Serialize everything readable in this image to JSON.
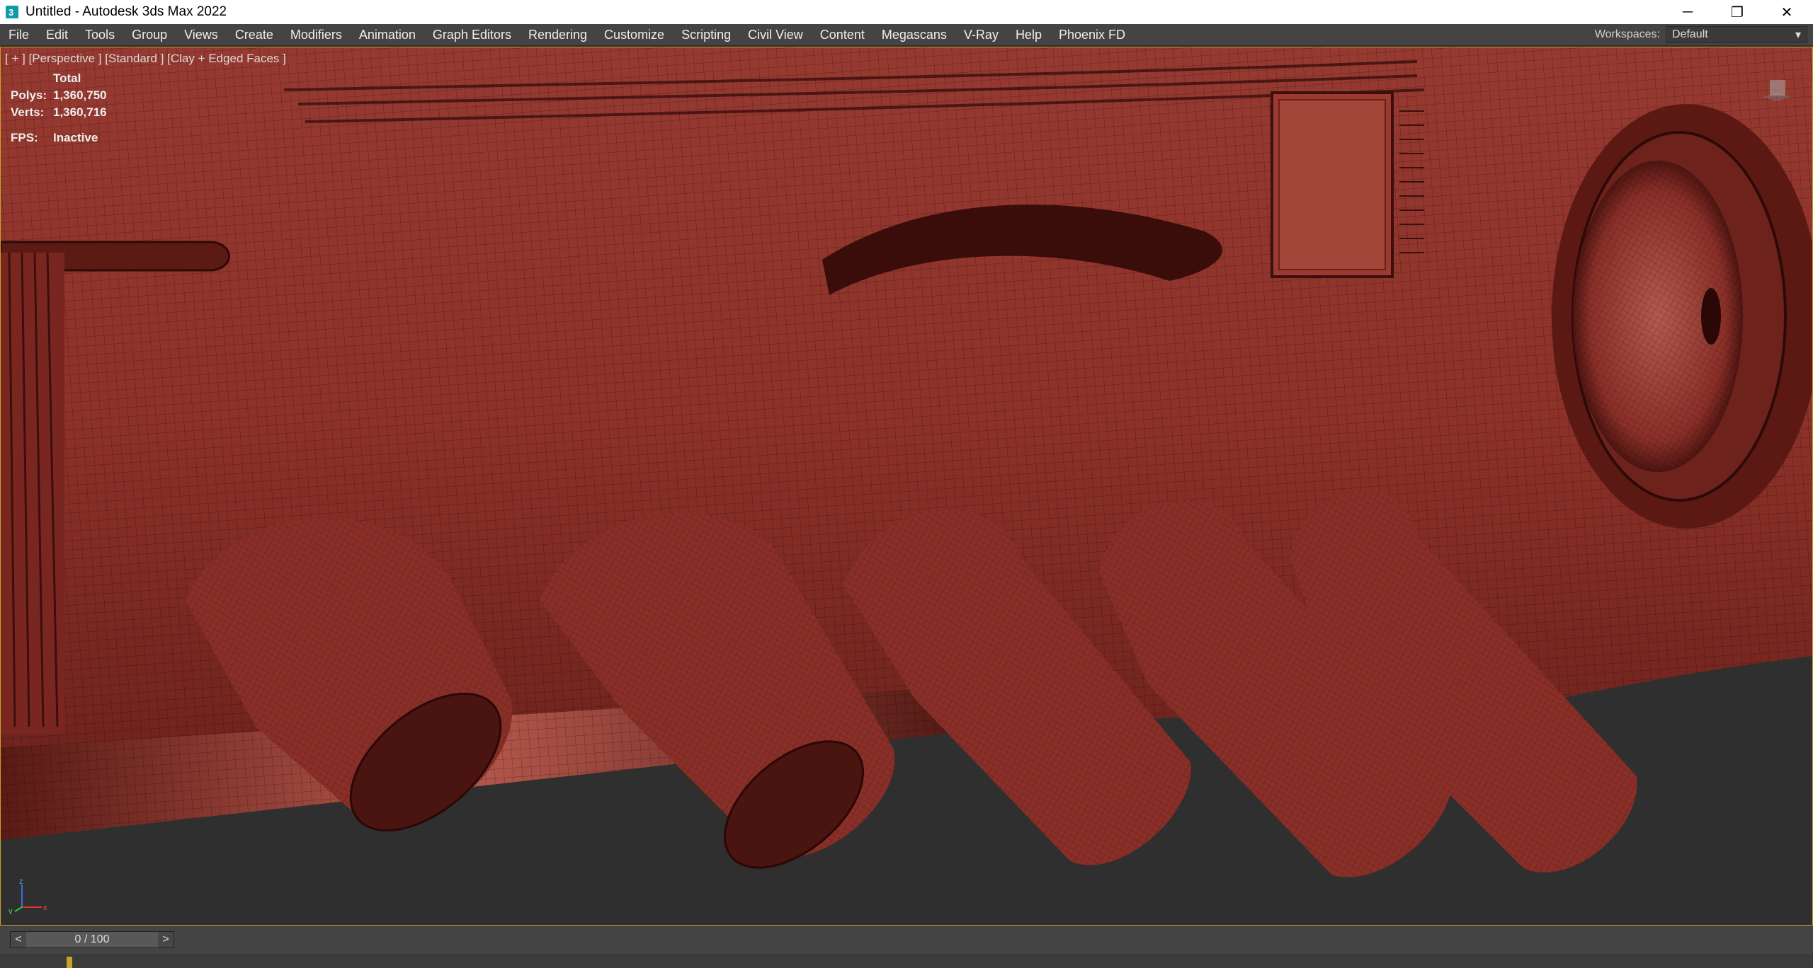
{
  "window": {
    "title": "Untitled - Autodesk 3ds Max 2022",
    "controls": {
      "minimize": "─",
      "restore": "❐",
      "close": "✕"
    }
  },
  "menu": {
    "items": [
      "File",
      "Edit",
      "Tools",
      "Group",
      "Views",
      "Create",
      "Modifiers",
      "Animation",
      "Graph Editors",
      "Rendering",
      "Customize",
      "Scripting",
      "Civil View",
      "Content",
      "Megascans",
      "V-Ray",
      "Help",
      "Phoenix FD"
    ]
  },
  "workspaces": {
    "label": "Workspaces:",
    "value": "Default"
  },
  "viewport": {
    "label": "[ + ] [Perspective ]  [Standard ] [Clay + Edged Faces ]",
    "stats": {
      "total_label": "Total",
      "polys_label": "Polys:",
      "polys": "1,360,750",
      "verts_label": "Verts:",
      "verts": "1,360,716",
      "fps_label": "FPS:",
      "fps": "Inactive"
    },
    "axis": {
      "x": "x",
      "y": "y",
      "z": "z"
    }
  },
  "timeline": {
    "prev": "<",
    "value": "0 / 100",
    "next": ">"
  },
  "colors": {
    "clay": "#8a2f28",
    "clay_light": "#b35145",
    "clay_dark": "#4c1410",
    "background": "#2f2f2f",
    "accent": "#c8a426"
  }
}
